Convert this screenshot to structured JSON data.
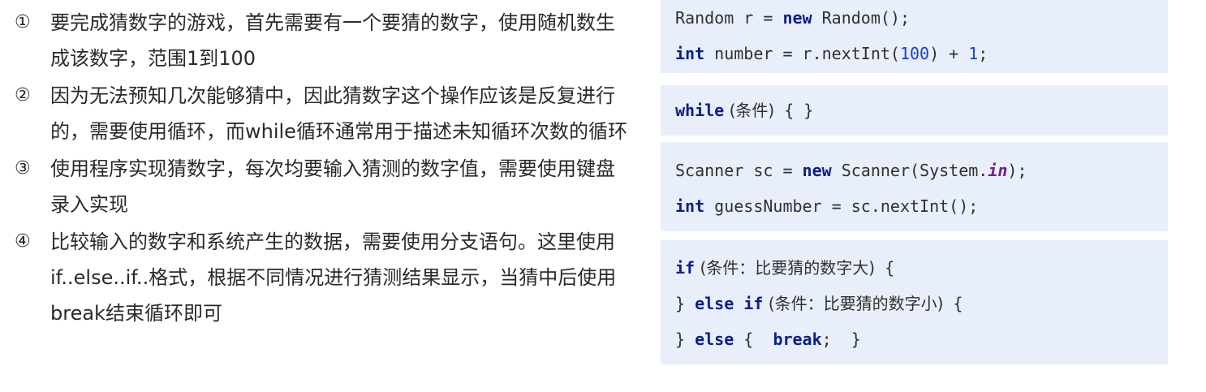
{
  "steps": [
    {
      "marker": "①",
      "lines": [
        "要完成猜数字的游戏，首先需要有一个要猜的数字，使用随机数生",
        "成该数字，范围1到100"
      ]
    },
    {
      "marker": "②",
      "lines": [
        "因为无法预知几次能够猜中，因此猜数字这个操作应该是反复进行",
        "的，需要使用循环，而while循环通常用于描述未知循环次数的循环"
      ]
    },
    {
      "marker": "③",
      "lines": [
        "使用程序实现猜数字，每次均要输入猜测的数字值，需要使用键盘",
        "录入实现"
      ]
    },
    {
      "marker": "④",
      "lines": [
        "比较输入的数字和系统产生的数据，需要使用分支语句。这里使用",
        "if..else..if..格式，根据不同情况进行猜测结果显示，当猜中后使用",
        "break结束循环即可"
      ]
    }
  ],
  "code": {
    "random": {
      "l1_a": "Random r = ",
      "l1_kw": "new",
      "l1_b": " Random();",
      "l2_kw": "int",
      "l2_a": " number = r.nextInt(",
      "l2_n1": "100",
      "l2_b": ") + ",
      "l2_n2": "1",
      "l2_c": ";"
    },
    "loop": {
      "kw": "while",
      "cond": " (条件)",
      "rest": " { }"
    },
    "scanner": {
      "l1_a": "Scanner sc = ",
      "l1_kw": "new",
      "l1_b": " Scanner(System.",
      "l1_field": "in",
      "l1_c": ");",
      "l2_kw": "int",
      "l2_a": " guessNumber = sc.nextInt();"
    },
    "branch": {
      "l1_kw": "if",
      "l1_cond": " (条件：比要猜的数字大)",
      "l1_rest": " {",
      "l2_a": "} ",
      "l2_kw1": "else",
      "l2_sp": " ",
      "l2_kw2": "if",
      "l2_cond": " (条件：比要猜的数字小)",
      "l2_rest": " {",
      "l3_a": "} ",
      "l3_kw1": "else",
      "l3_b": " {  ",
      "l3_kw2": "break",
      "l3_c": ";  }"
    }
  },
  "colors": {
    "code_background": "#e8eefa",
    "keyword": "#0a1f8a",
    "number_literal": "#1a3fd0",
    "static_field": "#7a1b8e"
  }
}
